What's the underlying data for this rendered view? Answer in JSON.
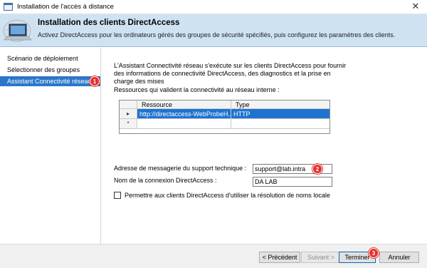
{
  "window": {
    "title": "Installation de l'accès à distance",
    "close_glyph": "✕"
  },
  "header": {
    "title": "Installation des clients DirectAccess",
    "subtitle": "Activez DirectAccess pour les ordinateurs gérés des groupes de sécurité spécifiés, puis configurez les paramètres des clients."
  },
  "sidebar": {
    "items": [
      {
        "label": "Scénario de déploiement",
        "active": false
      },
      {
        "label": "Sélectionner des groupes",
        "active": false
      },
      {
        "label": "Assistant Connectivité réseau",
        "active": true
      }
    ]
  },
  "main": {
    "intro": "L'Assistant Connectivité réseau s'exécute sur les clients DirectAccess pour fournir des informations de connectivité DirectAccess, des diagnostics et la prise en charge des mises",
    "resources_label": "Ressources qui valident la connectivité au réseau interne :",
    "grid": {
      "columns": [
        "Ressource",
        "Type"
      ],
      "rows": [
        {
          "marker": "▸",
          "resource": "http://directaccess-WebProbeH...",
          "type": "HTTP"
        },
        {
          "marker": "*",
          "resource": "",
          "type": ""
        }
      ]
    },
    "support_email_label": "Adresse de messagerie du support technique :",
    "support_email_value": "support@lab.intra",
    "connection_name_label": "Nom de la connexion DirectAccess :",
    "connection_name_value": "DA LAB",
    "local_name_resolution_label": "Permettre aux clients DirectAccess d'utiliser la résolution de noms locale",
    "local_name_resolution_checked": false
  },
  "footer": {
    "previous_label": "< Précédent",
    "next_label": "Suivant >",
    "finish_label": "Terminer",
    "cancel_label": "Annuler"
  },
  "annotations": {
    "badge_1": "1",
    "badge_2": "2",
    "badge_3": "3"
  },
  "colors": {
    "header_bg": "#cfe2f2",
    "selection": "#2a77c9",
    "badge": "#e5302b"
  }
}
